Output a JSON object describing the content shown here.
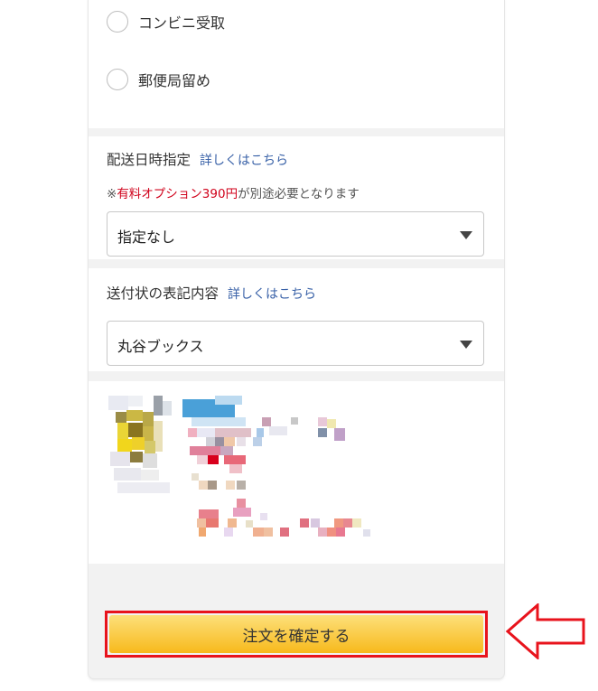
{
  "delivery_options": [
    {
      "label": "コンビニ受取"
    },
    {
      "label": "郵便局留め"
    }
  ],
  "delivery_date": {
    "title": "配送日時指定",
    "link": "詳しくはこちら",
    "note_prefix": "※",
    "note_highlight": "有料オプション390円",
    "note_suffix": "が別途必要となります",
    "selected": "指定なし"
  },
  "invoice_label": {
    "title": "送付状の表記内容",
    "link": "詳しくはこちら",
    "selected": "丸谷ブックス"
  },
  "confirm_button": {
    "label": "注文を確定する"
  },
  "colors": {
    "link": "#3a62a8",
    "note_highlight": "#d0021b",
    "button_gradient_top": "#fde07a",
    "button_gradient_bottom": "#f7b91c",
    "highlight_frame": "#e8131c"
  },
  "icons": {
    "annotation_arrow": "left-arrow-outline"
  }
}
